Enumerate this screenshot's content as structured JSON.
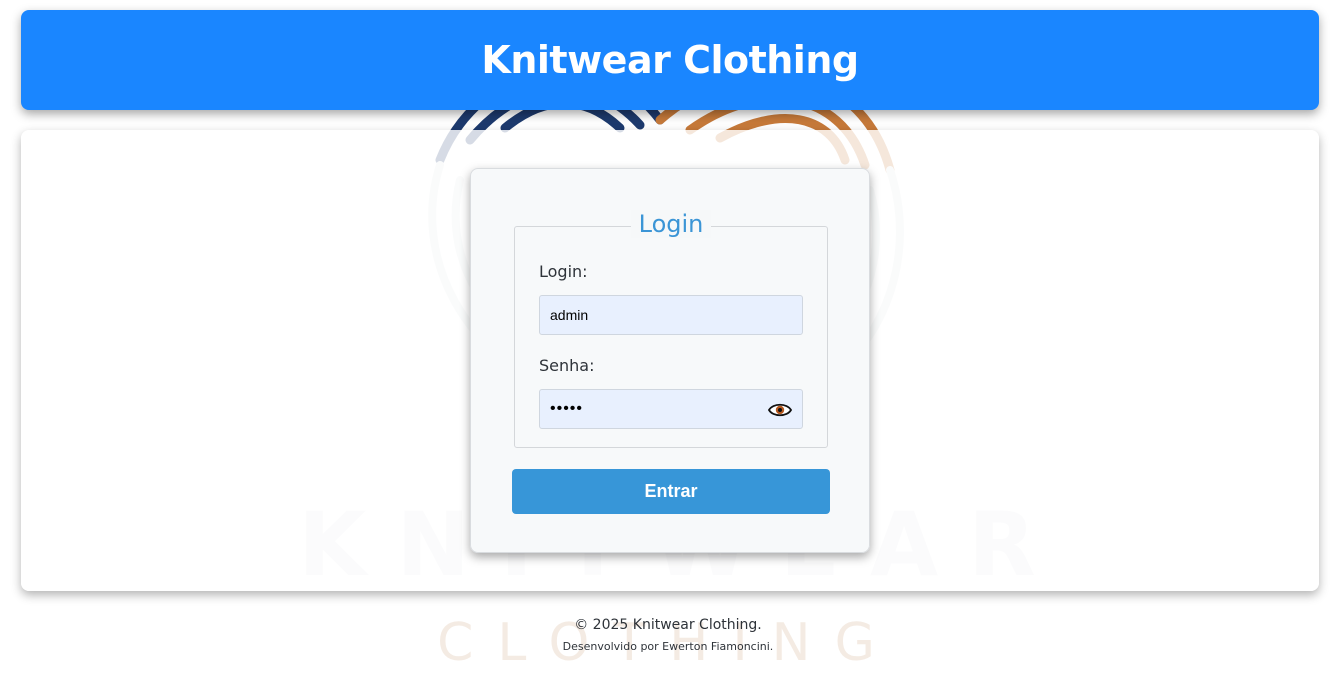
{
  "header": {
    "title": "Knitwear Clothing"
  },
  "watermark": {
    "brand_line1": "KNITWEAR",
    "brand_line2": "CLOTHING"
  },
  "login_form": {
    "legend": "Login",
    "username_label": "Login:",
    "username_value": "admin",
    "password_label": "Senha:",
    "password_value": "•••••",
    "show_password_icon": "eye-icon",
    "submit_label": "Entrar"
  },
  "footer": {
    "copyright": "© 2025 Knitwear Clothing.",
    "credits": "Desenvolvido por Ewerton Fiamoncini."
  },
  "colors": {
    "header_bg": "#1a86ff",
    "legend_text": "#3b95d6",
    "button_bg": "#3796d8",
    "input_bg": "#e8f0fe"
  }
}
